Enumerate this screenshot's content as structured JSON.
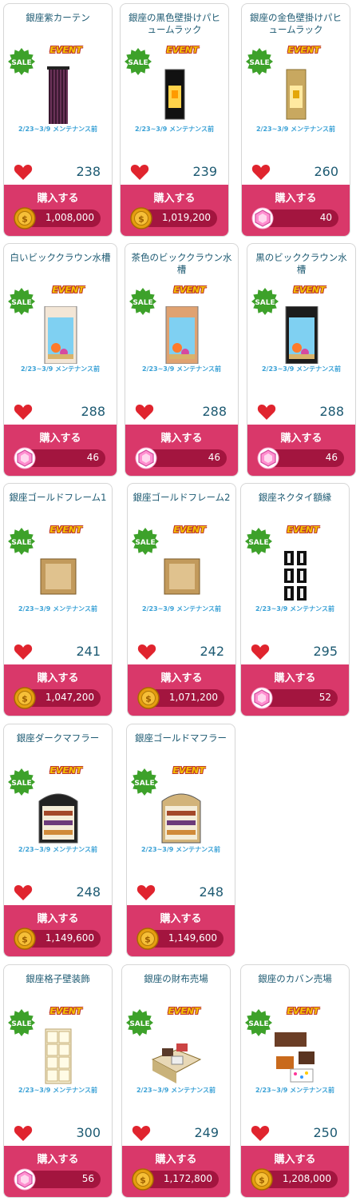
{
  "common": {
    "buy_label": "購入する",
    "event_label": "EVENT",
    "sale_label": "SALE",
    "period_label": "2/23~3/9 メンテナンス前",
    "colors": {
      "title": "#1d5a72",
      "buy": "#d9386a",
      "price_bar": "#a3153f",
      "heart": "#e0242e",
      "coin": "#e59e10",
      "gem": "#ff6ec0"
    }
  },
  "items": [
    {
      "name": "銀座紫カーテン",
      "likes": "238",
      "price": "1,008,000",
      "currency": "coin",
      "image": "curtain-icon"
    },
    {
      "name": "銀座の黒色壁掛けパヒュームラック",
      "likes": "239",
      "price": "1,019,200",
      "currency": "coin",
      "image": "wall-rack-black-icon"
    },
    {
      "name": "銀座の金色壁掛けパヒュームラック",
      "likes": "260",
      "price": "40",
      "currency": "gem",
      "image": "wall-rack-gold-icon"
    },
    {
      "name": "白いビッククラウン水槽",
      "likes": "288",
      "price": "46",
      "currency": "gem",
      "image": "aquarium-white-icon"
    },
    {
      "name": "茶色のビッククラウン水槽",
      "likes": "288",
      "price": "46",
      "currency": "gem",
      "image": "aquarium-brown-icon"
    },
    {
      "name": "黒のビッククラウン水槽",
      "likes": "288",
      "price": "46",
      "currency": "gem",
      "image": "aquarium-black-icon"
    },
    {
      "name": "銀座ゴールドフレーム1",
      "likes": "241",
      "price": "1,047,200",
      "currency": "coin",
      "image": "gold-frame-icon"
    },
    {
      "name": "銀座ゴールドフレーム2",
      "likes": "242",
      "price": "1,071,200",
      "currency": "coin",
      "image": "gold-frame-icon"
    },
    {
      "name": "銀座ネクタイ額縁",
      "likes": "295",
      "price": "52",
      "currency": "gem",
      "image": "necktie-frame-icon"
    },
    {
      "name": "銀座ダークマフラー",
      "likes": "248",
      "price": "1,149,600",
      "currency": "coin",
      "image": "scarf-shelf-dark-icon"
    },
    {
      "name": "銀座ゴールドマフラー",
      "likes": "248",
      "price": "1,149,600",
      "currency": "coin",
      "image": "scarf-shelf-gold-icon"
    },
    {
      "name": "銀座格子壁装飾",
      "likes": "300",
      "price": "56",
      "currency": "gem",
      "image": "lattice-wall-icon"
    },
    {
      "name": "銀座の財布売場",
      "likes": "249",
      "price": "1,172,800",
      "currency": "coin",
      "image": "wallet-counter-icon"
    },
    {
      "name": "銀座のカバン売場",
      "likes": "250",
      "price": "1,208,000",
      "currency": "coin",
      "image": "bag-counter-icon"
    }
  ]
}
